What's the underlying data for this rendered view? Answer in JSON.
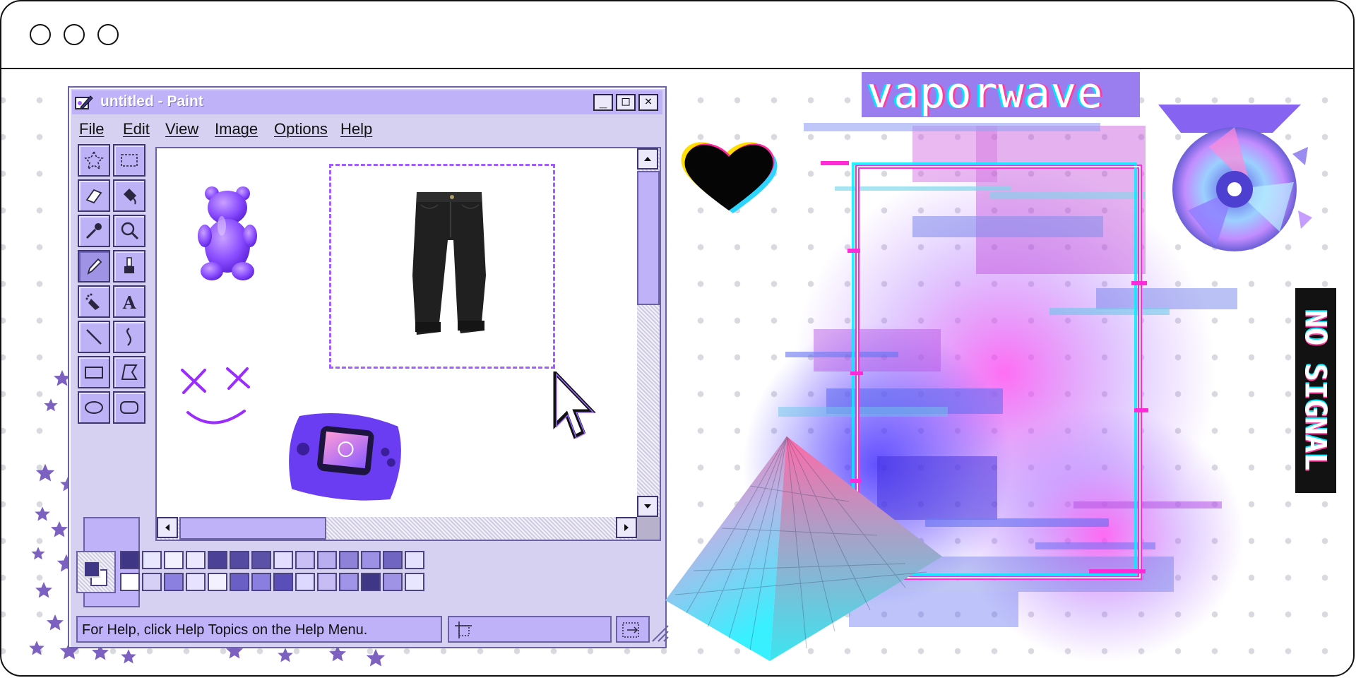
{
  "browser": {
    "window_controls": [
      "circle",
      "circle",
      "circle"
    ]
  },
  "paint": {
    "title": "untitled - Paint",
    "window_buttons": {
      "minimize": "_",
      "maximize": "□",
      "close": "×"
    },
    "menu": [
      {
        "label": "File"
      },
      {
        "label": "Edit"
      },
      {
        "label": "View"
      },
      {
        "label": "Image"
      },
      {
        "label": "Options"
      },
      {
        "label": "Help"
      }
    ],
    "tools": [
      "free-form-select-icon",
      "rect-select-icon",
      "eraser-icon",
      "fill-bucket-icon",
      "color-picker-icon",
      "magnifier-icon",
      "pencil-icon",
      "brush-icon",
      "airbrush-icon",
      "text-icon",
      "line-icon",
      "curve-icon",
      "rectangle-icon",
      "polygon-icon",
      "ellipse-icon",
      "rounded-rect-icon"
    ],
    "active_tool": "pencil-icon",
    "canvas_items": [
      "gummy-bear",
      "black-pants",
      "doodle-face",
      "game-console",
      "pixel-cursor"
    ],
    "palette": {
      "colors_top": [
        "#3f3685",
        "#e8e5ff",
        "#f2efff",
        "#ebe7ff",
        "#4b4196",
        "#544aa2",
        "#5b52a8",
        "#e3deff",
        "#c9bff5",
        "#b8adef",
        "#8e82d8",
        "#9c91e4",
        "#7066c2",
        "#e4e0ff"
      ],
      "colors_bottom": [
        "#ffffff",
        "#d6d0f7",
        "#8b7fe0",
        "#e6e2ff",
        "#f3f1ff",
        "#6a5fc4",
        "#8a7ee0",
        "#5a4fb8",
        "#ddd8ff",
        "#c7bdf4",
        "#a094e8",
        "#3f3685",
        "#9f93e6",
        "#e8e5ff"
      ],
      "foreground": "#3f3685",
      "background": "#ffffff"
    },
    "status": {
      "help_text": "For Help, click Help Topics on the Help Menu."
    },
    "accent": "#bfb2f8"
  },
  "collage": {
    "title_text": "vaporwave",
    "sign_text": "NO SIGNAL",
    "items": [
      "glitch-heart",
      "glitch-frame",
      "shattered-cd",
      "gradient-pyramid",
      "purple-stars"
    ]
  }
}
